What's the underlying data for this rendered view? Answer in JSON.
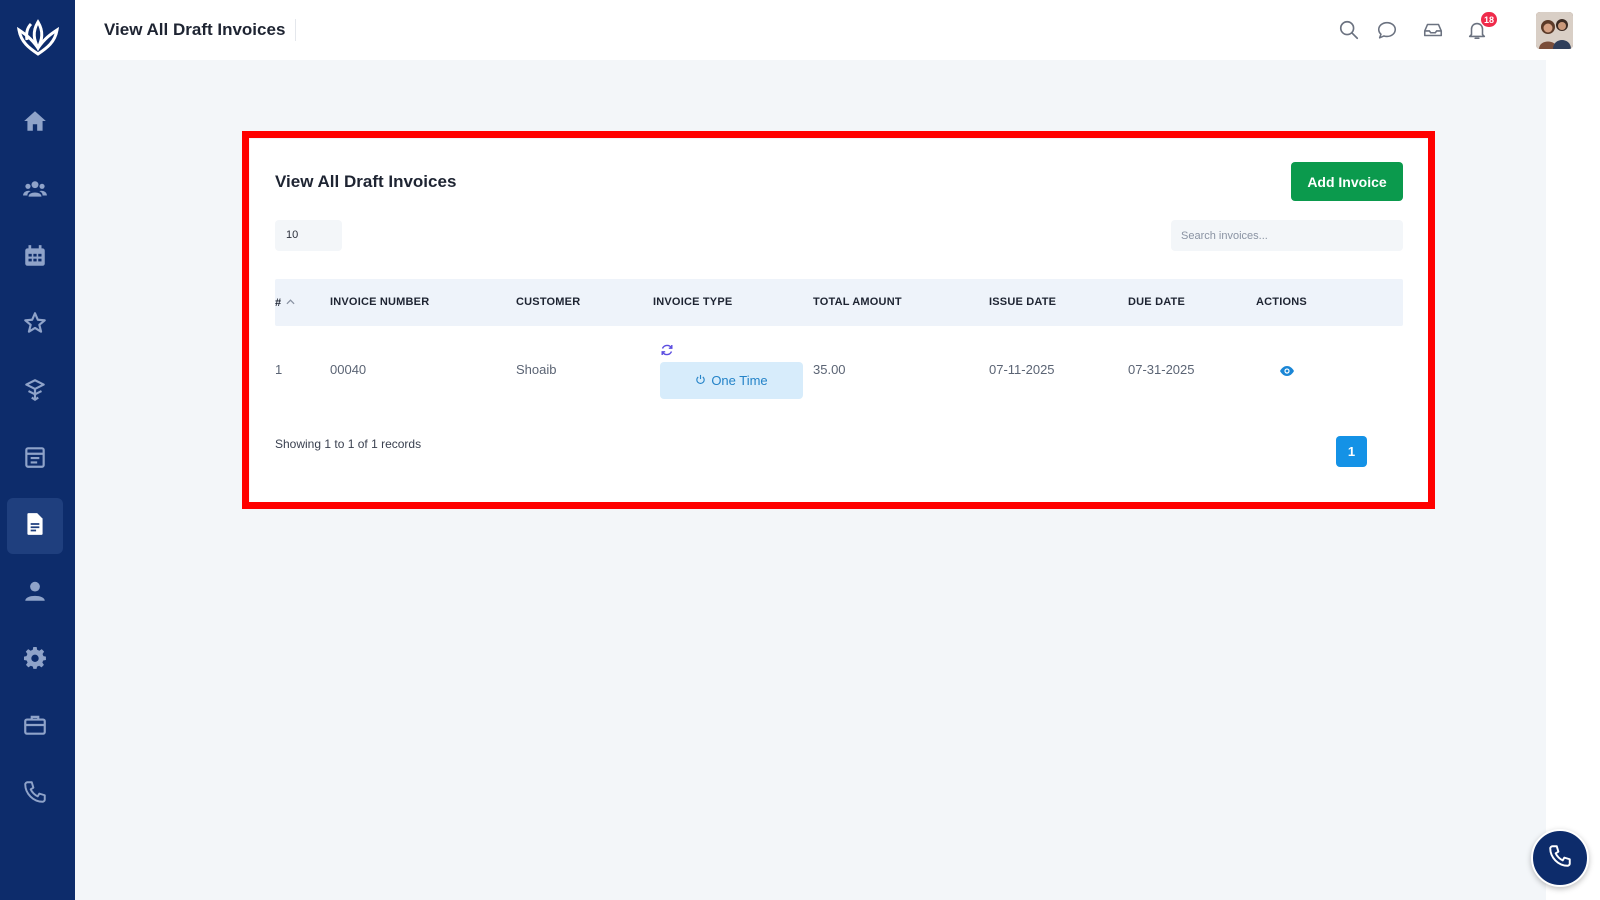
{
  "header": {
    "title": "View All Draft Invoices",
    "notification_count": "18"
  },
  "sidebar": {
    "items": [
      {
        "icon": "home-icon"
      },
      {
        "icon": "users-icon"
      },
      {
        "icon": "calendar-icon"
      },
      {
        "icon": "star-icon"
      },
      {
        "icon": "box-icon"
      },
      {
        "icon": "schedule-icon"
      },
      {
        "icon": "invoice-icon",
        "active": true
      },
      {
        "icon": "user-icon"
      },
      {
        "icon": "gear-icon"
      },
      {
        "icon": "briefcase-icon"
      },
      {
        "icon": "phone-icon"
      }
    ]
  },
  "card": {
    "title": "View All Draft Invoices",
    "add_button": "Add Invoice",
    "page_size": "10",
    "search_placeholder": "Search invoices...",
    "columns": [
      "#",
      "INVOICE NUMBER",
      "CUSTOMER",
      "INVOICE TYPE",
      "TOTAL AMOUNT",
      "ISSUE DATE",
      "DUE DATE",
      "ACTIONS"
    ],
    "rows": [
      {
        "index": "1",
        "invoice_number": "00040",
        "customer": "Shoaib",
        "invoice_type": "One Time",
        "total_amount": "35.00",
        "issue_date": "07-11-2025",
        "due_date": "07-31-2025"
      }
    ],
    "records_text": "Showing 1 to 1 of 1 records",
    "current_page": "1"
  },
  "colors": {
    "sidebar": "#0d2c6b",
    "primary_button": "#0b9a4d",
    "pagination_active": "#1492e6",
    "highlight_border": "#ff0000",
    "badge": "#ef2b4b"
  }
}
